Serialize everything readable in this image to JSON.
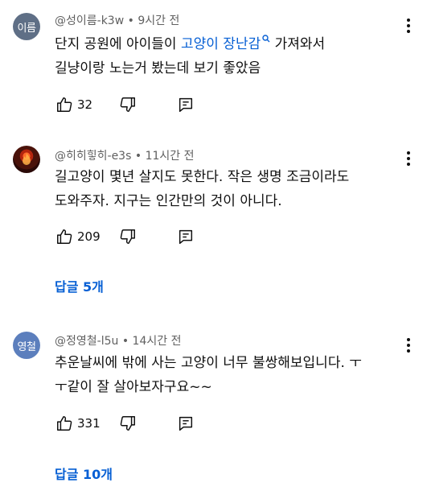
{
  "comments": [
    {
      "avatar_text": "이름",
      "avatar_color": "#5f6f86",
      "author": "@성이름-k3w",
      "time": "9시간 전",
      "text_before": "단지 공원에 아이들이 ",
      "link_text": "고양이 장난감",
      "text_after_line1": " 가져와서",
      "text_line2": "길냥이랑 노는거 봤는데 보기 좋았음",
      "likes": "32"
    },
    {
      "avatar_icon": "fire-avatar-icon",
      "author": "@히히힣히-e3s",
      "time": "11시간 전",
      "text_line1": "길고양이 몇년 살지도 못한다. 작은 생명 조금이라도",
      "text_line2": "도와주자. 지구는 인간만의 것이 아니다.",
      "likes": "209",
      "replies_label": "답글 5개"
    },
    {
      "avatar_text": "영철",
      "avatar_color": "#5c7fbd",
      "author": "@정영철-l5u",
      "time": "14시간 전",
      "text_line1": "추운날씨에 밖에 사는 고양이 너무 불쌍해보입니다. ㅜ",
      "text_line2": "ㅜ같이 잘 살아보자구요~~",
      "likes": "331",
      "replies_label": "답글 10개"
    }
  ],
  "separator": " • ",
  "colors": {
    "link": "#065fd4",
    "meta": "#606060",
    "text": "#0f0f0f"
  }
}
